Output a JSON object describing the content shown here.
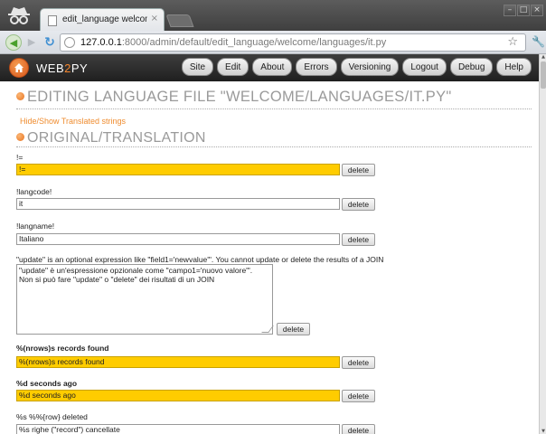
{
  "browser": {
    "tab_title": "edit_language welcome/lan",
    "tab_close": "×",
    "url_host": "127.0.0.1",
    "url_rest": ":8000/admin/default/edit_language/welcome/languages/it.py"
  },
  "navbar": {
    "brand_left": "WEB",
    "brand_num": "2",
    "brand_right": "PY",
    "links": [
      "Site",
      "Edit",
      "About",
      "Errors",
      "Versioning",
      "Logout",
      "Debug",
      "Help"
    ]
  },
  "page": {
    "title": "EDITING LANGUAGE FILE \"WELCOME/LANGUAGES/IT.PY\"",
    "toggle_link": "Hide/Show Translated strings",
    "section_title": "ORIGINAL/TRANSLATION",
    "delete_label": "delete",
    "entries": [
      {
        "key": "!=",
        "value": "!=",
        "untranslated": true,
        "bold": false
      },
      {
        "key": "!langcode!",
        "value": "it",
        "untranslated": false,
        "bold": false
      },
      {
        "key": "!langname!",
        "value": "Italiano",
        "untranslated": false,
        "bold": false
      },
      {
        "key": "\"update\" is an optional expression like \"field1='newvalue'\". You cannot update or delete the results of a JOIN",
        "value": "\"update\" è un'espressione opzionale come \"campo1='nuovo valore'\".\nNon si può fare \"update\" o \"delete\" dei risultati di un JOIN",
        "untranslated": false,
        "bold": false
      },
      {
        "key": "%(nrows)s records found",
        "value": "%(nrows)s records found",
        "untranslated": true,
        "bold": true
      },
      {
        "key": "%d seconds ago",
        "value": "%d seconds ago",
        "untranslated": true,
        "bold": true
      },
      {
        "key": "%s %%{row} deleted",
        "value": "%s righe (\"record\") cancellate",
        "untranslated": false,
        "bold": false
      }
    ]
  },
  "colors": {
    "untranslated_bg": "#ffcc00",
    "accent": "#ef8c2f",
    "navbar_bg": "#1f1f1f"
  }
}
